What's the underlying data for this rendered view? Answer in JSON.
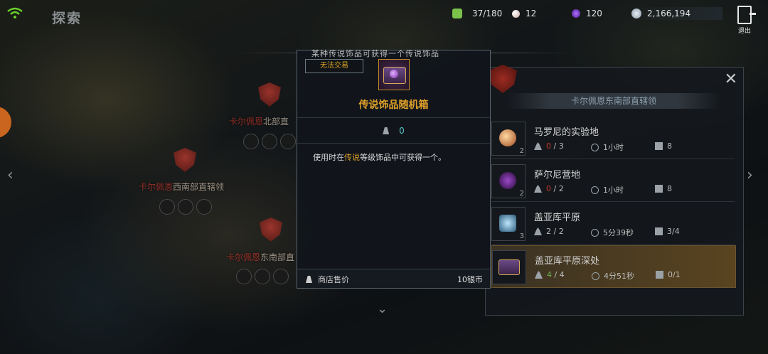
{
  "header": {
    "title": "探索"
  },
  "resources": {
    "energy": {
      "value": "37/180",
      "icon": "energy-icon",
      "color": "#7ac24a"
    },
    "pearl": {
      "value": "12",
      "icon": "pearl-icon",
      "color": "#e0c9c4"
    },
    "crystal": {
      "value": "120",
      "icon": "crystal-icon",
      "color": "#8a44d8"
    },
    "silver": {
      "value": "2,166,194",
      "icon": "silver-coin-icon",
      "color": "#b8c4d0"
    }
  },
  "exit": {
    "label": "退出"
  },
  "map": {
    "labels": [
      {
        "red": "卡尔佩恩",
        "rest": "北部直"
      },
      {
        "red": "卡尔佩恩",
        "rest": "西南部直辖领"
      },
      {
        "red": "卡尔佩恩",
        "rest": "东南部直"
      }
    ]
  },
  "tooltip": {
    "header_text": "某种传说饰品可获得一个传说饰品",
    "trade_status": "无法交易",
    "item_name": "传说饰品随机箱",
    "weight": "0",
    "description_pre": "使用时在",
    "description_highlight": "传说",
    "description_post": "等级饰品中可获得一个。",
    "shop_label": "商店售价",
    "shop_price": "10银币"
  },
  "panel": {
    "title": "卡尔佩恩东南部直辖领",
    "rows": [
      {
        "name": "马罗尼的实验地",
        "count": "2",
        "progress_cur": "0",
        "progress_total": "/ 3",
        "time": "1小时",
        "slots": "8",
        "gem_color": "#e0a060"
      },
      {
        "name": "萨尔尼营地",
        "count": "2",
        "progress_cur": "0",
        "progress_total": "/ 2",
        "time": "1小时",
        "slots": "8",
        "gem_color": "#6a2a8a"
      },
      {
        "name": "盖亚库平原",
        "count": "3",
        "progress_cur": "2",
        "progress_total": "/ 2",
        "time": "5分39秒",
        "slots": "3/4",
        "gem_color": "#5aa8c8"
      },
      {
        "name": "盖亚库平原深处",
        "count": "",
        "progress_cur": "4",
        "progress_total": "/ 4",
        "time": "4分51秒",
        "slots": "0/1",
        "gem_color": "#7a3aa0"
      }
    ]
  }
}
